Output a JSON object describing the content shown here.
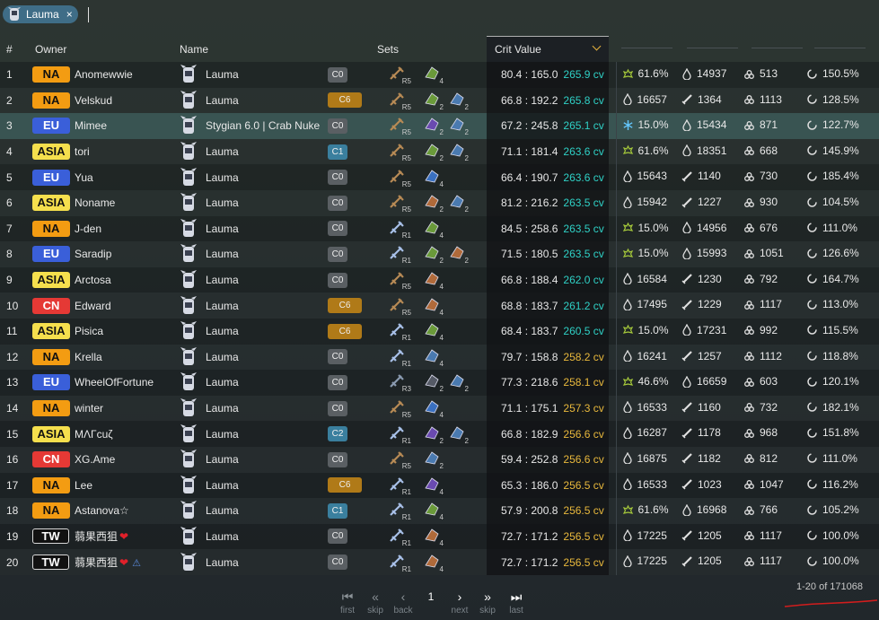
{
  "search": {
    "chip_label": "Lauma",
    "chip_close": "×"
  },
  "headers": {
    "num": "#",
    "owner": "Owner",
    "name": "Name",
    "sets": "Sets",
    "crit": "Crit Value"
  },
  "regions": {
    "NA": {
      "bg": "#f39c12",
      "fg": "#111111"
    },
    "EU": {
      "bg": "#3a5fd9",
      "fg": "#ffffff"
    },
    "ASIA": {
      "bg": "#f5df4d",
      "fg": "#111111"
    },
    "CN": {
      "bg": "#e53935",
      "fg": "#ffffff"
    },
    "TW": {
      "bg": "#111111",
      "fg": "#ffffff"
    }
  },
  "rows": [
    {
      "n": "1",
      "region": "NA",
      "owner": "Anomewwie",
      "name": "Lauma",
      "cons": "C0",
      "wr": "R5",
      "sets": [
        {
          "c": "#6a9a3a",
          "n": "4"
        }
      ],
      "crit": "80.4 : 165.0",
      "cv": "265.9 cv",
      "cvc": "#2fd1c6",
      "s1i": "em",
      "s1": "61.6%",
      "s2i": "hp",
      "s2": "14937",
      "s3i": "em",
      "s3": "513",
      "s4": "150.5%"
    },
    {
      "n": "2",
      "region": "NA",
      "owner": "Velskud",
      "name": "Lauma",
      "cons": "C6",
      "wr": "R5",
      "sets": [
        {
          "c": "#6a9a3a",
          "n": "2"
        },
        {
          "c": "#4a7ab0",
          "n": "2"
        }
      ],
      "crit": "66.8 : 192.2",
      "cv": "265.8 cv",
      "cvc": "#2fd1c6",
      "s1i": "hp",
      "s1": "16657",
      "s2i": "atk",
      "s2": "1364",
      "s3i": "em",
      "s3": "1113",
      "s4": "128.5%"
    },
    {
      "n": "3",
      "region": "EU",
      "owner": "Mimee",
      "name": "Stygian 6.0 | Crab Nuke",
      "cons": "C0",
      "wr": "R5",
      "sets": [
        {
          "c": "#6a4ab0",
          "n": "2"
        },
        {
          "c": "#4a7ab0",
          "n": "2"
        }
      ],
      "crit": "67.2 : 245.8",
      "cv": "265.1 cv",
      "cvc": "#2fd1c6",
      "s1i": "cryo",
      "s1": "15.0%",
      "s2i": "hp",
      "s2": "15434",
      "s3i": "em",
      "s3": "871",
      "s4": "122.7%",
      "hl": true
    },
    {
      "n": "4",
      "region": "ASIA",
      "owner": "tori",
      "name": "Lauma",
      "cons": "C1",
      "wr": "R5",
      "sets": [
        {
          "c": "#6a9a3a",
          "n": "2"
        },
        {
          "c": "#4a7ab0",
          "n": "2"
        }
      ],
      "crit": "71.1 : 181.4",
      "cv": "263.6 cv",
      "cvc": "#2fd1c6",
      "s1i": "em",
      "s1": "61.6%",
      "s2i": "hp",
      "s2": "18351",
      "s3i": "em",
      "s3": "668",
      "s4": "145.9%"
    },
    {
      "n": "5",
      "region": "EU",
      "owner": "Yua",
      "name": "Lauma",
      "cons": "C0",
      "wr": "R5",
      "sets": [
        {
          "c": "#3a70c0",
          "n": "4"
        }
      ],
      "crit": "66.4 : 190.7",
      "cv": "263.6 cv",
      "cvc": "#2fd1c6",
      "s1i": "hp",
      "s1": "15643",
      "s2i": "atk",
      "s2": "1140",
      "s3i": "em",
      "s3": "730",
      "s4": "185.4%"
    },
    {
      "n": "6",
      "region": "ASIA",
      "owner": "Noname",
      "name": "Lauma",
      "cons": "C0",
      "wr": "R5",
      "sets": [
        {
          "c": "#b06a3a",
          "n": "2"
        },
        {
          "c": "#4a7ab0",
          "n": "2"
        }
      ],
      "crit": "81.2 : 216.2",
      "cv": "263.5 cv",
      "cvc": "#2fd1c6",
      "s1i": "hp",
      "s1": "15942",
      "s2i": "atk",
      "s2": "1227",
      "s3i": "em",
      "s3": "930",
      "s4": "104.5%"
    },
    {
      "n": "7",
      "region": "NA",
      "owner": "J-den",
      "name": "Lauma",
      "cons": "C0",
      "wr": "R1",
      "sets": [
        {
          "c": "#6a9a3a",
          "n": "4"
        }
      ],
      "crit": "84.5 : 258.6",
      "cv": "263.5 cv",
      "cvc": "#2fd1c6",
      "s1i": "em",
      "s1": "15.0%",
      "s2i": "hp",
      "s2": "14956",
      "s3i": "em",
      "s3": "676",
      "s4": "111.0%"
    },
    {
      "n": "8",
      "region": "EU",
      "owner": "Saradip",
      "name": "Lauma",
      "cons": "C0",
      "wr": "R1",
      "sets": [
        {
          "c": "#6a9a3a",
          "n": "2"
        },
        {
          "c": "#b06a3a",
          "n": "2"
        }
      ],
      "crit": "71.5 : 180.5",
      "cv": "263.5 cv",
      "cvc": "#2fd1c6",
      "s1i": "em",
      "s1": "15.0%",
      "s2i": "hp",
      "s2": "15993",
      "s3i": "em",
      "s3": "1051",
      "s4": "126.6%"
    },
    {
      "n": "9",
      "region": "ASIA",
      "owner": "Arctosa",
      "name": "Lauma",
      "cons": "C0",
      "wr": "R5",
      "sets": [
        {
          "c": "#b06a3a",
          "n": "4"
        }
      ],
      "crit": "66.8 : 188.4",
      "cv": "262.0 cv",
      "cvc": "#2fd1c6",
      "s1i": "hp",
      "s1": "16584",
      "s2i": "atk",
      "s2": "1230",
      "s3i": "em",
      "s3": "792",
      "s4": "164.7%"
    },
    {
      "n": "10",
      "region": "CN",
      "owner": "Edward",
      "name": "Lauma",
      "cons": "C6",
      "wr": "R5",
      "sets": [
        {
          "c": "#b06a3a",
          "n": "4"
        }
      ],
      "crit": "68.8 : 183.7",
      "cv": "261.2 cv",
      "cvc": "#2fd1c6",
      "s1i": "hp",
      "s1": "17495",
      "s2i": "atk",
      "s2": "1229",
      "s3i": "em",
      "s3": "1117",
      "s4": "113.0%"
    },
    {
      "n": "11",
      "region": "ASIA",
      "owner": "Pisica",
      "name": "Lauma",
      "cons": "C6",
      "wr": "R1",
      "sets": [
        {
          "c": "#6a9a3a",
          "n": "4"
        }
      ],
      "crit": "68.4 : 183.7",
      "cv": "260.5 cv",
      "cvc": "#2fd1c6",
      "s1i": "em",
      "s1": "15.0%",
      "s2i": "hp",
      "s2": "17231",
      "s3i": "em",
      "s3": "992",
      "s4": "115.5%"
    },
    {
      "n": "12",
      "region": "NA",
      "owner": "Krella",
      "name": "Lauma",
      "cons": "C0",
      "wr": "R1",
      "sets": [
        {
          "c": "#4a7ab0",
          "n": "4"
        }
      ],
      "crit": "79.7 : 158.8",
      "cv": "258.2 cv",
      "cvc": "#e8b83c",
      "s1i": "hp",
      "s1": "16241",
      "s2i": "atk",
      "s2": "1257",
      "s3i": "em",
      "s3": "1112",
      "s4": "118.8%"
    },
    {
      "n": "13",
      "region": "EU",
      "owner": "WheelOfFortune",
      "name": "Lauma",
      "cons": "C0",
      "wr": "R3",
      "sets": [
        {
          "c": "#555a66",
          "n": "2"
        },
        {
          "c": "#4a7ab0",
          "n": "2"
        }
      ],
      "crit": "77.3 : 218.6",
      "cv": "258.1 cv",
      "cvc": "#e8b83c",
      "s1i": "em",
      "s1": "46.6%",
      "s2i": "hp",
      "s2": "16659",
      "s3i": "em",
      "s3": "603",
      "s4": "120.1%"
    },
    {
      "n": "14",
      "region": "NA",
      "owner": "winter",
      "name": "Lauma",
      "cons": "C0",
      "wr": "R5",
      "sets": [
        {
          "c": "#3a70c0",
          "n": "4"
        }
      ],
      "crit": "71.1 : 175.1",
      "cv": "257.3 cv",
      "cvc": "#e8b83c",
      "s1i": "hp",
      "s1": "16533",
      "s2i": "atk",
      "s2": "1160",
      "s3i": "em",
      "s3": "732",
      "s4": "182.1%"
    },
    {
      "n": "15",
      "region": "ASIA",
      "owner": "ΜΛΓcuζ",
      "name": "Lauma",
      "cons": "C2",
      "wr": "R1",
      "sets": [
        {
          "c": "#6a4ab0",
          "n": "2"
        },
        {
          "c": "#4a7ab0",
          "n": "2"
        }
      ],
      "crit": "66.8 : 182.9",
      "cv": "256.6 cv",
      "cvc": "#e8b83c",
      "s1i": "hp",
      "s1": "16287",
      "s2i": "atk",
      "s2": "1178",
      "s3i": "em",
      "s3": "968",
      "s4": "151.8%"
    },
    {
      "n": "16",
      "region": "CN",
      "owner": "XG.Ame",
      "name": "Lauma",
      "cons": "C0",
      "wr": "R5",
      "sets": [
        {
          "c": "#4a7ab0",
          "n": "2"
        }
      ],
      "crit": "59.4 : 252.8",
      "cv": "256.6 cv",
      "cvc": "#e8b83c",
      "s1i": "hp",
      "s1": "16875",
      "s2i": "atk",
      "s2": "1182",
      "s3i": "em",
      "s3": "812",
      "s4": "111.0%"
    },
    {
      "n": "17",
      "region": "NA",
      "owner": "Lee",
      "name": "Lauma",
      "cons": "C6",
      "wr": "R1",
      "sets": [
        {
          "c": "#6a4ab0",
          "n": "4"
        }
      ],
      "crit": "65.3 : 186.0",
      "cv": "256.5 cv",
      "cvc": "#e8b83c",
      "s1i": "hp",
      "s1": "16533",
      "s2i": "atk",
      "s2": "1023",
      "s3i": "em",
      "s3": "1047",
      "s4": "116.2%"
    },
    {
      "n": "18",
      "region": "NA",
      "owner": "Astanova☆",
      "name": "Lauma",
      "cons": "C1",
      "wr": "R1",
      "sets": [
        {
          "c": "#6a9a3a",
          "n": "4"
        }
      ],
      "crit": "57.9 : 200.8",
      "cv": "256.5 cv",
      "cvc": "#e8b83c",
      "s1i": "em",
      "s1": "61.6%",
      "s2i": "hp",
      "s2": "16968",
      "s3i": "em",
      "s3": "766",
      "s4": "105.2%"
    },
    {
      "n": "19",
      "region": "TW",
      "owner": "蒻果西狙",
      "heart": true,
      "name": "Lauma",
      "cons": "C0",
      "wr": "R1",
      "sets": [
        {
          "c": "#b06a3a",
          "n": "4"
        }
      ],
      "crit": "72.7 : 171.2",
      "cv": "256.5 cv",
      "cvc": "#e8b83c",
      "s1i": "hp",
      "s1": "17225",
      "s2i": "atk",
      "s2": "1205",
      "s3i": "em",
      "s3": "1117",
      "s4": "100.0%",
      "green": true
    },
    {
      "n": "20",
      "region": "TW",
      "owner": "蒻果西狙",
      "heart": true,
      "tri": true,
      "name": "Lauma",
      "cons": "C0",
      "wr": "R1",
      "sets": [
        {
          "c": "#b06a3a",
          "n": "4"
        }
      ],
      "crit": "72.7 : 171.2",
      "cv": "256.5 cv",
      "cvc": "#e8b83c",
      "s1i": "hp",
      "s1": "17225",
      "s2i": "atk",
      "s2": "1205",
      "s3i": "em",
      "s3": "1117",
      "s4": "100.0%",
      "green": true
    }
  ],
  "pager": {
    "first": "first",
    "skip_back": "skip",
    "back": "back",
    "page": "1",
    "next": "next",
    "skip_fwd": "skip",
    "last": "last"
  },
  "count": "1-20 of 171068",
  "colors": {
    "accent": "#e6b13c",
    "cons_c0": "#5a5f63",
    "cons_c1": "#3a7f9e",
    "cons_c2": "#3a7f9e",
    "cons_c6": "#b07a18"
  }
}
